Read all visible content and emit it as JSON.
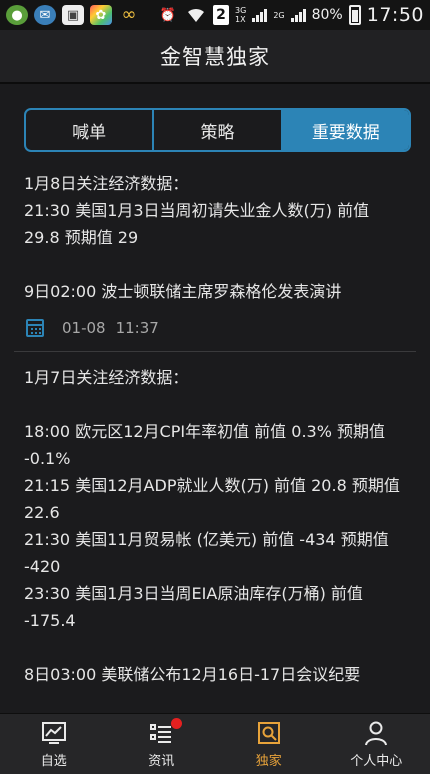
{
  "status_bar": {
    "sim_number": "2",
    "network_1": "3G",
    "network_1b": "1X",
    "network_2": "2G",
    "battery": "80%",
    "time": "17:50",
    "icons": [
      "app-icon",
      "app-icon",
      "image-icon",
      "app-icon",
      "infinity-icon",
      "alarm-icon",
      "wifi-icon"
    ]
  },
  "header": {
    "title": "金智慧独家"
  },
  "tabs": [
    {
      "label": "喊单",
      "active": false
    },
    {
      "label": "策略",
      "active": false
    },
    {
      "label": "重要数据",
      "active": true
    }
  ],
  "posts": [
    {
      "lines": [
        "1月8日关注经济数据：",
        "21:30 美国1月3日当周初请失业金人数(万) 前值 29.8 预期值 29",
        "",
        "9日02:00 波士顿联储主席罗森格伦发表演讲"
      ],
      "date": "01-08",
      "time": "11:37"
    },
    {
      "lines": [
        "1月7日关注经济数据：",
        "",
        "18:00 欧元区12月CPI年率初值 前值 0.3% 预期值 -0.1%",
        "21:15 美国12月ADP就业人数(万) 前值 20.8 预期值 22.6",
        "21:30 美国11月贸易帐 (亿美元) 前值 -434 预期值 -420",
        "23:30 美国1月3日当周EIA原油库存(万桶) 前值 -175.4",
        "",
        "8日03:00 美联储公布12月16日-17日会议纪要"
      ]
    }
  ],
  "bottom_nav": [
    {
      "label": "自选",
      "icon": "chart-icon",
      "active": false,
      "badge": false
    },
    {
      "label": "资讯",
      "icon": "list-icon",
      "active": false,
      "badge": true
    },
    {
      "label": "独家",
      "icon": "exclusive-icon",
      "active": true,
      "badge": false
    },
    {
      "label": "个人中心",
      "icon": "person-icon",
      "active": false,
      "badge": false
    }
  ],
  "colors": {
    "accent": "#2c84b6",
    "active_nav": "#e8a33a",
    "badge": "#e52020",
    "background": "#1b1b1d"
  }
}
